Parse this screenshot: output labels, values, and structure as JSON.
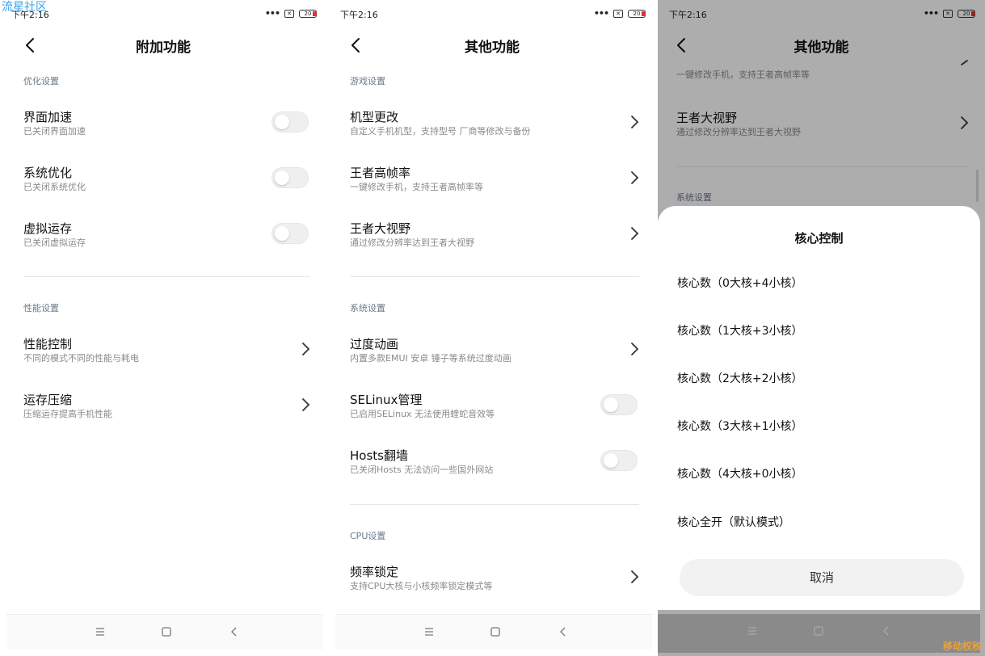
{
  "watermark": "流星社区",
  "status": {
    "time": "下午2:16",
    "battery": "20"
  },
  "panel1": {
    "title": "附加功能",
    "sections": [
      {
        "label": "优化设置"
      },
      {
        "label": "性能设置"
      }
    ],
    "items": [
      {
        "name": "界面加速",
        "desc": "已关闭界面加速"
      },
      {
        "name": "系统优化",
        "desc": "已关闭系统优化"
      },
      {
        "name": "虚拟运存",
        "desc": "已关闭虚拟运存"
      },
      {
        "name": "性能控制",
        "desc": "不同的模式不同的性能与耗电"
      },
      {
        "name": "运存压缩",
        "desc": "压缩运存提高手机性能"
      }
    ]
  },
  "panel2": {
    "title": "其他功能",
    "sections": [
      {
        "label": "游戏设置"
      },
      {
        "label": "系统设置"
      },
      {
        "label": "CPU设置"
      }
    ],
    "items": [
      {
        "name": "机型更改",
        "desc": "自定义手机机型，支持型号 厂商等修改与备份"
      },
      {
        "name": "王者高帧率",
        "desc": "一键修改手机，支持王者高帧率等"
      },
      {
        "name": "王者大视野",
        "desc": "通过修改分辨率达到王者大视野"
      },
      {
        "name": "过度动画",
        "desc": "内置多款EMUI 安卓 锤子等系统过度动画"
      },
      {
        "name": "SELinux管理",
        "desc": "已启用SELinux 无法使用蝰蛇音效等"
      },
      {
        "name": "Hosts翻墙",
        "desc": "已关闭Hosts 无法访问一些国外网站"
      },
      {
        "name": "频率锁定",
        "desc": "支持CPU大核与小核频率锁定模式等"
      }
    ]
  },
  "panel3": {
    "title": "其他功能",
    "bg_partial_desc": "一键修改手机，支持王者高帧率等",
    "bg_item": {
      "name": "王者大视野",
      "desc": "通过修改分辨率达到王者大视野"
    },
    "bg_section": "系统设置",
    "sheet": {
      "title": "核心控制",
      "options": [
        "核心数（0大核+4小核）",
        "核心数（1大核+3小核）",
        "核心数（2大核+2小核）",
        "核心数（3大核+1小核）",
        "核心数（4大核+0小核）",
        "核心全开（默认模式）"
      ],
      "cancel": "取消"
    },
    "logo_text": "移动权税"
  },
  "colors": {
    "section_label": "#6b7a8c",
    "desc": "#8a8a8a",
    "watermark": "#3aa0e8",
    "battery_low": "#e03030"
  }
}
